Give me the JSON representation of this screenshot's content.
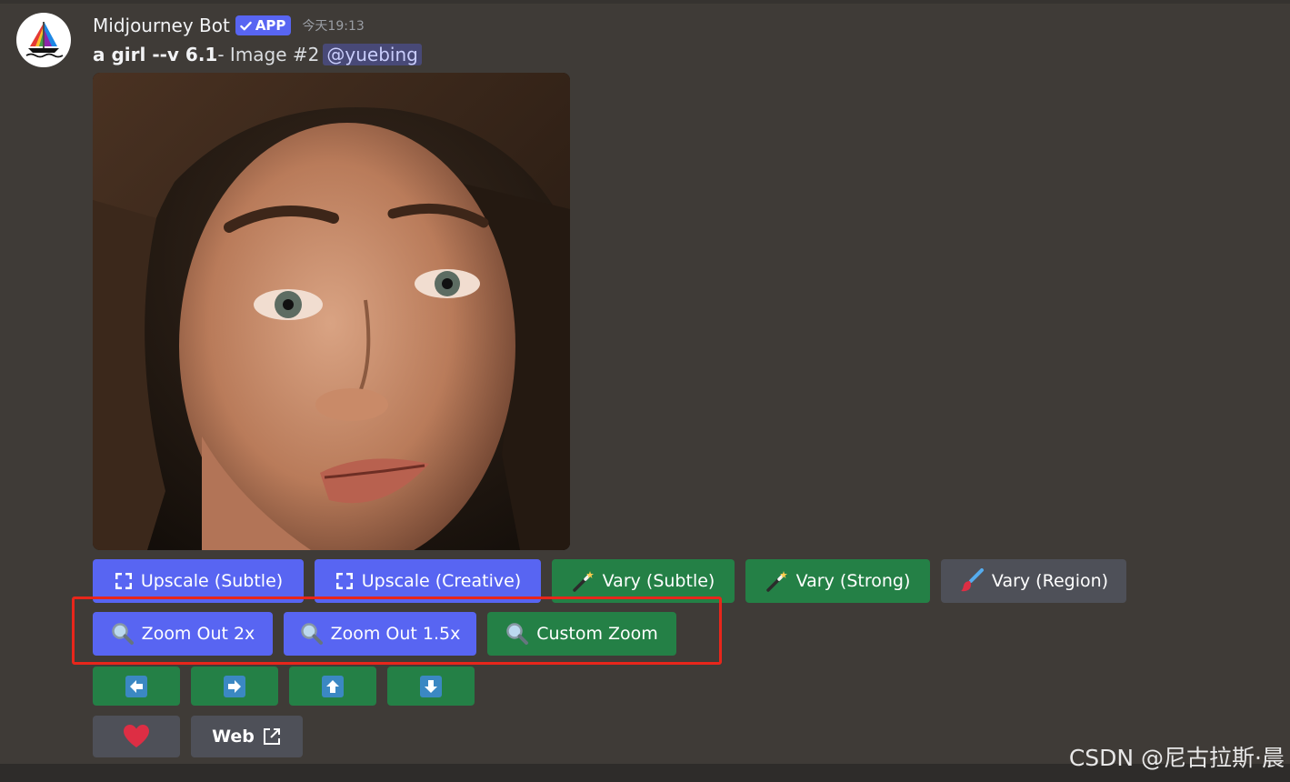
{
  "message": {
    "author": "Midjourney Bot",
    "badge": "APP",
    "timestamp": "今天19:13",
    "prompt_bold": "a girl --v 6.1",
    "prompt_rest": " - Image #2",
    "mention": "@yuebing"
  },
  "buttons": {
    "row1": [
      {
        "label": "Upscale (Subtle)",
        "icon": "expand-arrows-icon"
      },
      {
        "label": "Upscale (Creative)",
        "icon": "expand-arrows-icon"
      },
      {
        "label": "Vary (Subtle)",
        "icon": "magic-wand-icon"
      },
      {
        "label": "Vary (Strong)",
        "icon": "magic-wand-icon"
      },
      {
        "label": "Vary (Region)",
        "icon": "paintbrush-icon"
      }
    ],
    "row2": [
      {
        "label": "Zoom Out 2x",
        "icon": "magnifier-icon"
      },
      {
        "label": "Zoom Out 1.5x",
        "icon": "magnifier-icon"
      },
      {
        "label": "Custom Zoom",
        "icon": "magnifier-icon"
      }
    ],
    "row3": [
      "arrow-left-icon",
      "arrow-right-icon",
      "arrow-up-icon",
      "arrow-down-icon"
    ],
    "row4": {
      "favorite_icon": "heart-icon",
      "web_label": "Web",
      "web_icon": "external-link-icon"
    }
  },
  "colors": {
    "blurple": "#5865f2",
    "green": "#248046",
    "gray": "#4e5058",
    "highlight": "#e8261b",
    "background": "#3f3b37"
  },
  "watermark": "CSDN @尼古拉斯·晨"
}
